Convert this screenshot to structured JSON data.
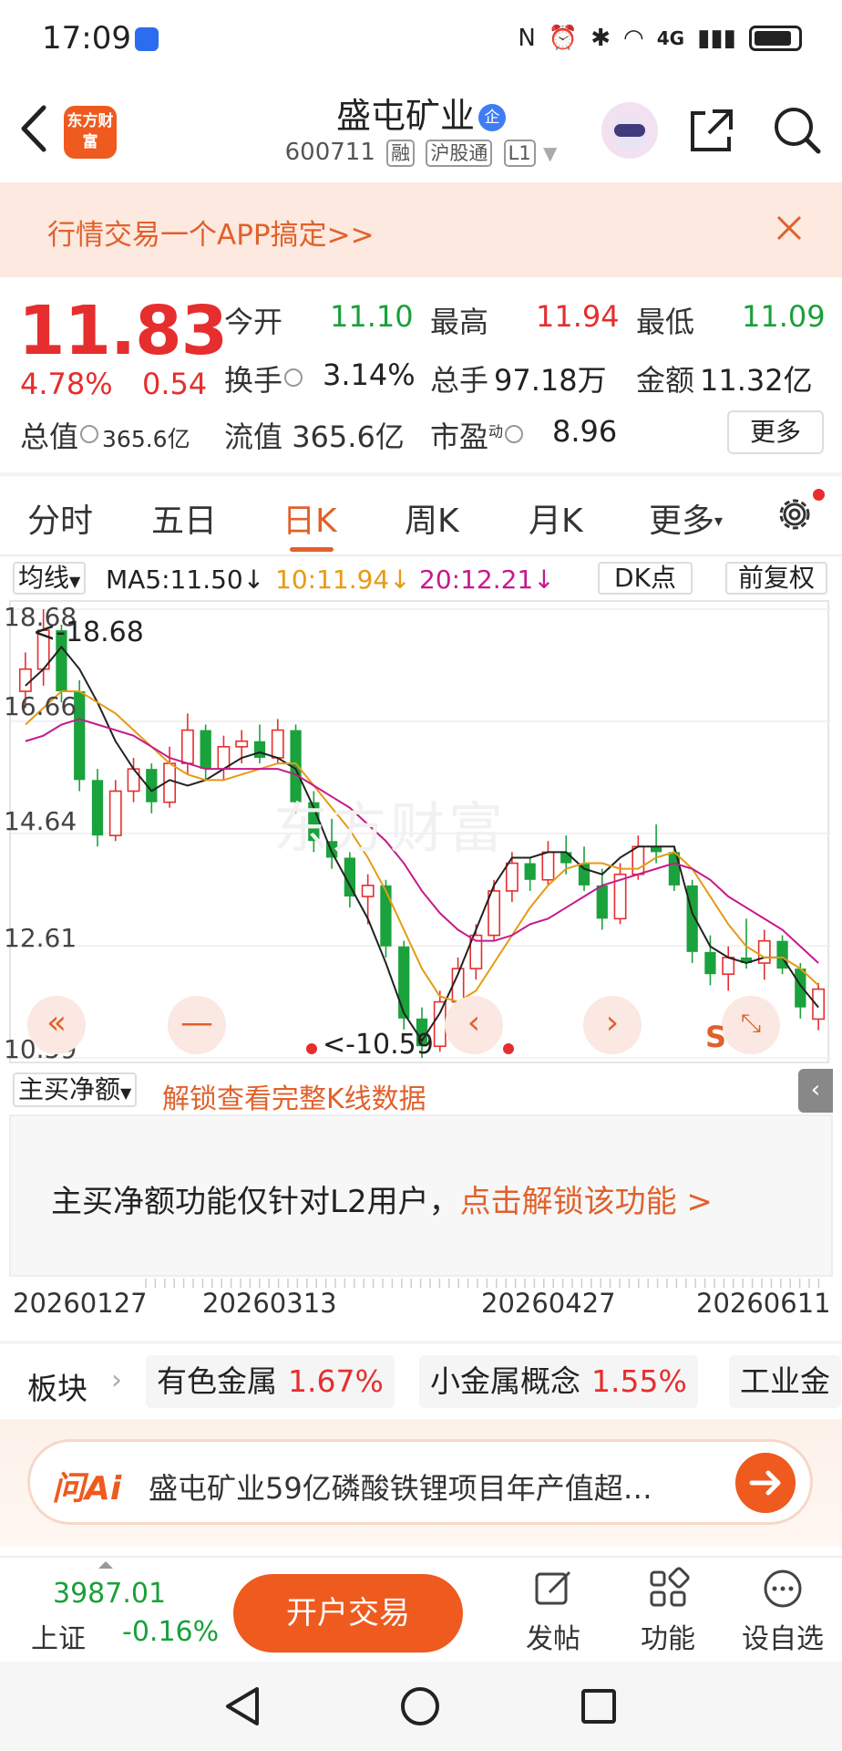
{
  "status_bar": {
    "time": "17:09",
    "network": "4G"
  },
  "header": {
    "stock_name": "盛屯矿业",
    "enterprise_badge": "企",
    "stock_code": "600711",
    "tags": [
      "融",
      "沪股通",
      "L1"
    ],
    "brand": "东方财富"
  },
  "banner": {
    "text": "行情交易一个APP搞定>>"
  },
  "quote": {
    "price": "11.83",
    "change_pct": "4.78%",
    "change": "0.54",
    "open_label": "今开",
    "open": "11.10",
    "high_label": "最高",
    "high": "11.94",
    "low_label": "最低",
    "low": "11.09",
    "turnover_label": "换手",
    "turnover": "3.14%",
    "volume_label": "总手",
    "volume": "97.18万",
    "amount_label": "金额",
    "amount": "11.32亿",
    "mktcap_label": "总值",
    "mktcap": "365.6亿",
    "float_label": "流值",
    "float_cap": "365.6亿",
    "pe_label": "市盈",
    "pe_sup": "动",
    "pe": "8.96",
    "more_label": "更多"
  },
  "tabs": [
    "分时",
    "五日",
    "日K",
    "周K",
    "月K",
    "更多"
  ],
  "active_tab": "日K",
  "ma_row": {
    "selector": "均线",
    "ma5": "MA5:11.50↓",
    "ma10": "10:11.94↓",
    "ma20": "20:12.21↓",
    "dk_label": "DK点",
    "adjust_label": "前复权"
  },
  "chart_labels": {
    "y_ticks": [
      "18.68",
      "16.66",
      "14.64",
      "12.61",
      "10.59"
    ],
    "peak_label": "<-18.68",
    "low_label": "<-10.59",
    "watermark": "东方财富",
    "s_mark": "S",
    "dates": [
      "20260127",
      "20260313",
      "20260427",
      "20260611"
    ]
  },
  "chart_data": {
    "type": "candlestick",
    "ylim": [
      10.59,
      18.68
    ],
    "y_ticks": [
      18.68,
      16.66,
      14.64,
      12.61,
      10.59
    ],
    "x_ticks": [
      "20260127",
      "20260313",
      "20260427",
      "20260611"
    ],
    "series": [
      {
        "name": "MA5",
        "values": [
          17.3,
          17.6,
          18.0,
          17.6,
          17.0,
          16.3,
          15.8,
          15.4,
          15.6,
          15.5,
          15.6,
          15.8,
          16.0,
          16.1,
          16.0,
          15.8,
          15.1,
          14.3,
          13.7,
          13.1,
          12.3,
          11.4,
          10.9,
          11.4,
          12.1,
          12.9,
          13.7,
          14.2,
          14.2,
          14.3,
          14.3,
          14.0,
          13.9,
          14.2,
          14.4,
          14.4,
          14.4,
          13.2,
          12.6,
          12.4,
          12.3,
          12.4,
          12.4,
          11.9,
          11.5
        ]
      },
      {
        "name": "MA10",
        "values": [
          16.6,
          16.9,
          17.2,
          17.2,
          17.0,
          16.8,
          16.5,
          16.2,
          15.9,
          15.7,
          15.6,
          15.6,
          15.7,
          15.8,
          15.9,
          15.9,
          15.5,
          15.1,
          14.7,
          14.2,
          13.6,
          12.9,
          12.2,
          11.7,
          11.6,
          11.8,
          12.3,
          12.8,
          13.3,
          13.7,
          14.0,
          14.1,
          14.1,
          14.0,
          14.0,
          14.2,
          14.3,
          14.0,
          13.5,
          13.0,
          12.6,
          12.4,
          12.4,
          12.2,
          11.9
        ]
      },
      {
        "name": "MA20",
        "values": [
          16.3,
          16.4,
          16.6,
          16.7,
          16.6,
          16.5,
          16.4,
          16.2,
          16.0,
          15.9,
          15.8,
          15.8,
          15.8,
          15.8,
          15.8,
          15.7,
          15.5,
          15.3,
          15.1,
          14.8,
          14.5,
          14.1,
          13.6,
          13.2,
          12.9,
          12.7,
          12.7,
          12.8,
          13.0,
          13.1,
          13.3,
          13.5,
          13.7,
          13.8,
          13.9,
          14.0,
          14.1,
          14.0,
          13.8,
          13.5,
          13.3,
          13.1,
          12.9,
          12.6,
          12.3
        ]
      }
    ],
    "candles": [
      {
        "o": 17.2,
        "h": 17.9,
        "l": 16.9,
        "c": 17.6
      },
      {
        "o": 17.6,
        "h": 18.68,
        "l": 17.3,
        "c": 18.3
      },
      {
        "o": 18.3,
        "h": 18.4,
        "l": 17.0,
        "c": 17.2
      },
      {
        "o": 17.2,
        "h": 17.4,
        "l": 15.4,
        "c": 15.6
      },
      {
        "o": 15.6,
        "h": 15.8,
        "l": 14.4,
        "c": 14.6
      },
      {
        "o": 14.6,
        "h": 15.6,
        "l": 14.5,
        "c": 15.4
      },
      {
        "o": 15.4,
        "h": 16.0,
        "l": 15.2,
        "c": 15.8
      },
      {
        "o": 15.8,
        "h": 15.9,
        "l": 15.0,
        "c": 15.2
      },
      {
        "o": 15.2,
        "h": 16.2,
        "l": 15.1,
        "c": 15.9
      },
      {
        "o": 15.9,
        "h": 16.8,
        "l": 15.7,
        "c": 16.5
      },
      {
        "o": 16.5,
        "h": 16.6,
        "l": 15.6,
        "c": 15.8
      },
      {
        "o": 15.8,
        "h": 16.4,
        "l": 15.6,
        "c": 16.2
      },
      {
        "o": 16.2,
        "h": 16.5,
        "l": 15.9,
        "c": 16.3
      },
      {
        "o": 16.3,
        "h": 16.6,
        "l": 15.9,
        "c": 16.0
      },
      {
        "o": 16.0,
        "h": 16.7,
        "l": 15.9,
        "c": 16.5
      },
      {
        "o": 16.5,
        "h": 16.6,
        "l": 15.0,
        "c": 15.2
      },
      {
        "o": 15.2,
        "h": 15.4,
        "l": 14.3,
        "c": 14.5
      },
      {
        "o": 14.5,
        "h": 14.9,
        "l": 14.0,
        "c": 14.2
      },
      {
        "o": 14.2,
        "h": 14.3,
        "l": 13.3,
        "c": 13.5
      },
      {
        "o": 13.5,
        "h": 13.9,
        "l": 13.0,
        "c": 13.7
      },
      {
        "o": 13.7,
        "h": 13.8,
        "l": 12.4,
        "c": 12.6
      },
      {
        "o": 12.6,
        "h": 12.7,
        "l": 11.1,
        "c": 11.3
      },
      {
        "o": 11.3,
        "h": 11.5,
        "l": 10.59,
        "c": 10.8
      },
      {
        "o": 10.8,
        "h": 11.8,
        "l": 10.7,
        "c": 11.6
      },
      {
        "o": 11.6,
        "h": 12.4,
        "l": 11.5,
        "c": 12.2
      },
      {
        "o": 12.2,
        "h": 13.0,
        "l": 12.0,
        "c": 12.8
      },
      {
        "o": 12.8,
        "h": 13.8,
        "l": 12.7,
        "c": 13.6
      },
      {
        "o": 13.6,
        "h": 14.3,
        "l": 13.4,
        "c": 14.1
      },
      {
        "o": 14.1,
        "h": 14.2,
        "l": 13.6,
        "c": 13.8
      },
      {
        "o": 13.8,
        "h": 14.5,
        "l": 13.7,
        "c": 14.3
      },
      {
        "o": 14.3,
        "h": 14.6,
        "l": 13.9,
        "c": 14.1
      },
      {
        "o": 14.1,
        "h": 14.4,
        "l": 13.6,
        "c": 13.7
      },
      {
        "o": 13.7,
        "h": 14.0,
        "l": 12.9,
        "c": 13.1
      },
      {
        "o": 13.1,
        "h": 14.1,
        "l": 13.0,
        "c": 13.9
      },
      {
        "o": 13.9,
        "h": 14.6,
        "l": 13.8,
        "c": 14.4
      },
      {
        "o": 14.4,
        "h": 14.8,
        "l": 14.1,
        "c": 14.3
      },
      {
        "o": 14.3,
        "h": 14.4,
        "l": 13.6,
        "c": 13.7
      },
      {
        "o": 13.7,
        "h": 13.8,
        "l": 12.3,
        "c": 12.5
      },
      {
        "o": 12.5,
        "h": 12.8,
        "l": 11.9,
        "c": 12.1
      },
      {
        "o": 12.1,
        "h": 12.6,
        "l": 11.8,
        "c": 12.4
      },
      {
        "o": 12.4,
        "h": 13.1,
        "l": 12.2,
        "c": 12.3
      },
      {
        "o": 12.3,
        "h": 12.9,
        "l": 12.0,
        "c": 12.7
      },
      {
        "o": 12.7,
        "h": 12.8,
        "l": 12.1,
        "c": 12.2
      },
      {
        "o": 12.2,
        "h": 12.3,
        "l": 11.3,
        "c": 11.5
      },
      {
        "o": 11.29,
        "h": 11.94,
        "l": 11.09,
        "c": 11.83
      }
    ]
  },
  "main_buy": {
    "selector": "主买净额",
    "unlock_text": "解锁查看完整K线数据",
    "l2_text": "主买净额功能仅针对L2用户，",
    "l2_link": "点击解锁该功能 >"
  },
  "sectors": {
    "title": "板块",
    "items": [
      {
        "name": "有色金属",
        "pct": "1.67%"
      },
      {
        "name": "小金属概念",
        "pct": "1.55%"
      },
      {
        "name": "工业金",
        "pct": ""
      }
    ]
  },
  "ai_search": {
    "logo": "问Ai",
    "text": "盛屯矿业59亿磷酸铁锂项目年产值超…"
  },
  "bottom_nav": {
    "index_value": "3987.01",
    "index_name": "上证",
    "index_change": "-0.16%",
    "open_account": "开户交易",
    "items": [
      "发帖",
      "功能",
      "设自选"
    ]
  }
}
